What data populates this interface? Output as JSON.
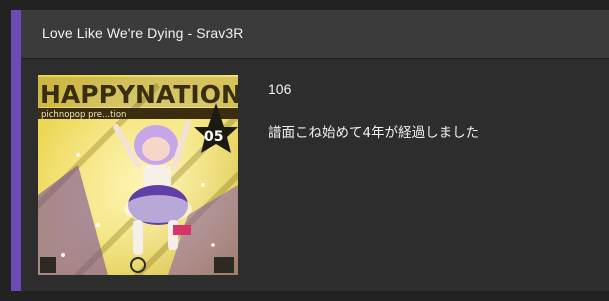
{
  "card": {
    "title": "Love Like We're Dying - Srav3R",
    "accent_color": "#6f49b8",
    "cover": {
      "kind": "album-artwork",
      "logo_text": "HAPPYNATION",
      "subtitle_text": "pichnopop pre...tion",
      "badge_number": "05"
    },
    "play_count": "106",
    "comment": "譜面こね始めて4年が経過しました"
  }
}
